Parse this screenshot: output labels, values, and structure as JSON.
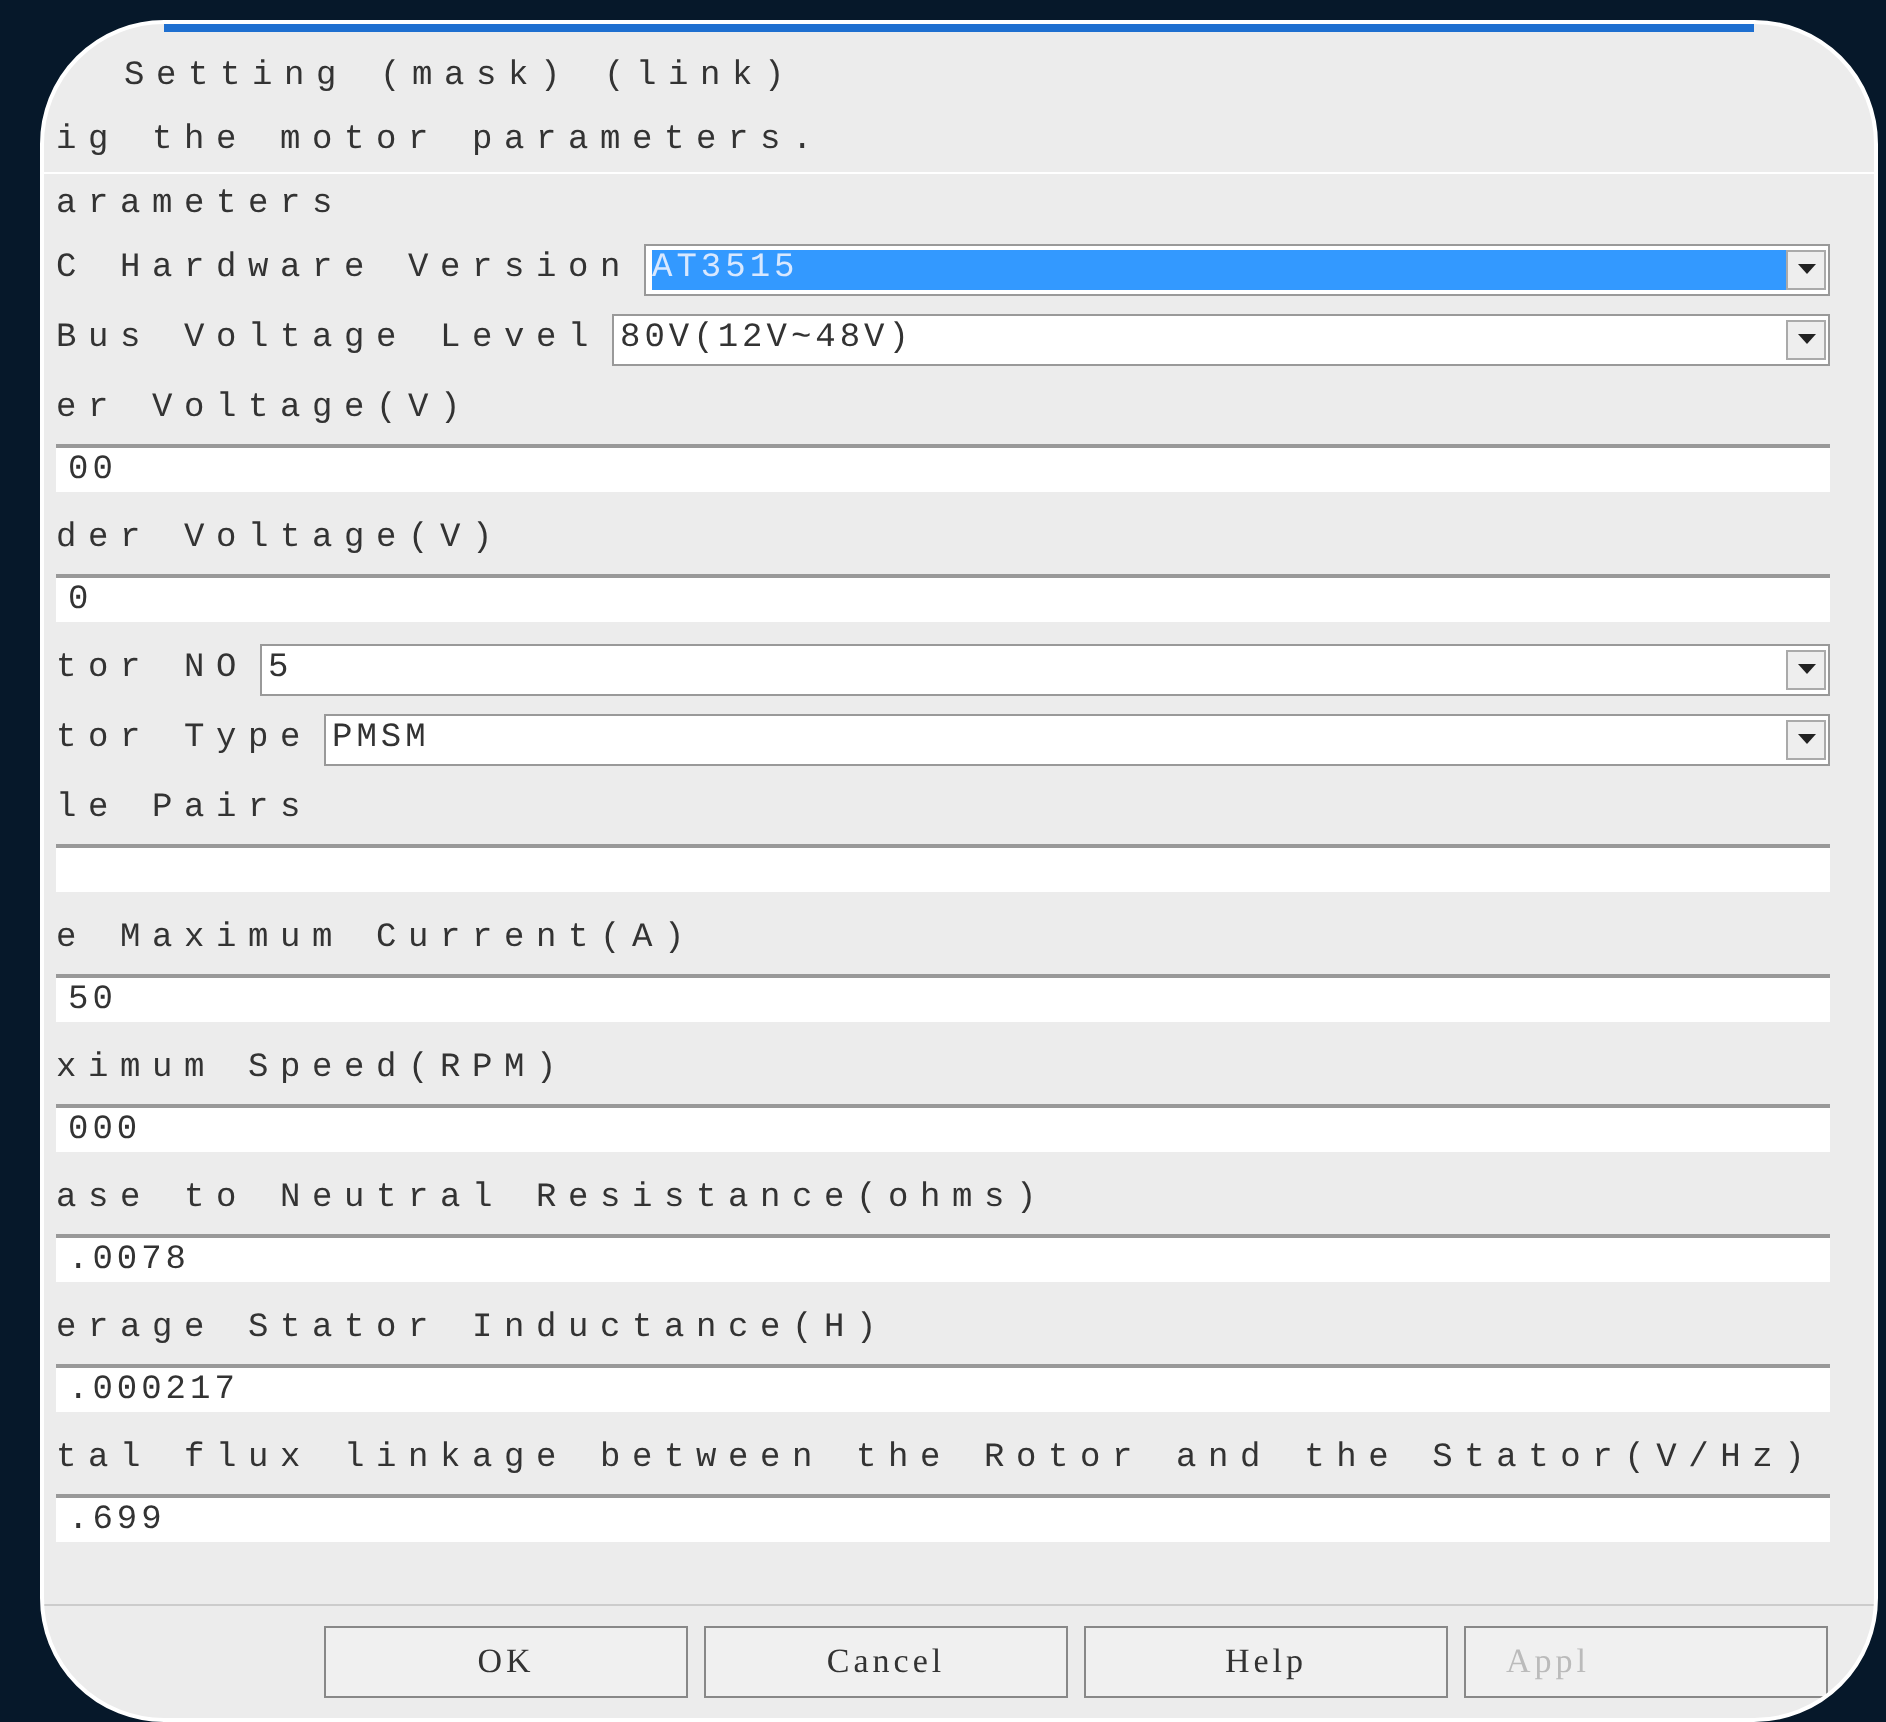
{
  "block_title": "Setting (mask) (link)",
  "description": "ig the motor parameters.",
  "section": "arameters",
  "params": [
    {
      "kind": "dropdown",
      "label": "C Hardware Version",
      "value": "AT3515",
      "highlighted": true
    },
    {
      "kind": "dropdown",
      "label": "Bus Voltage Level",
      "value": "80V(12V~48V)",
      "highlighted": false
    },
    {
      "kind": "edit",
      "label": "er Voltage(V)",
      "value": "00"
    },
    {
      "kind": "edit",
      "label": "der Voltage(V)",
      "value": "0"
    },
    {
      "kind": "dropdown",
      "label": "tor NO",
      "value": "5",
      "highlighted": false
    },
    {
      "kind": "dropdown",
      "label": "tor Type",
      "value": "PMSM",
      "highlighted": false
    },
    {
      "kind": "edit",
      "label": "le Pairs"
    },
    {
      "kind": "edit",
      "label": "e Maximum Current(A)",
      "value": "50"
    },
    {
      "kind": "edit",
      "label": "ximum Speed(RPM)",
      "value": "000"
    },
    {
      "kind": "edit",
      "label": "ase to Neutral Resistance(ohms)",
      "value": ".0078"
    },
    {
      "kind": "edit",
      "label": "erage Stator Inductance(H)",
      "value": ".000217"
    },
    {
      "kind": "edit",
      "label": "tal flux linkage between the Rotor and the Stator(V/Hz)",
      "value": ".699"
    }
  ],
  "buttons": [
    {
      "label": "OK",
      "disabled": false
    },
    {
      "label": "Cancel",
      "disabled": false
    },
    {
      "label": "Help",
      "disabled": false
    },
    {
      "label": "Appl",
      "disabled": true
    }
  ]
}
